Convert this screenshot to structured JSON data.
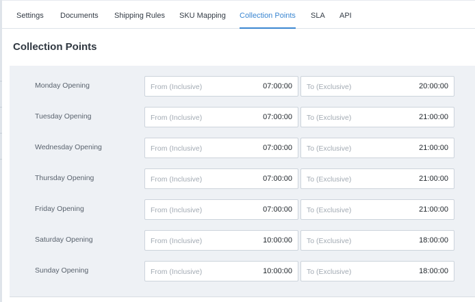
{
  "tabs": [
    {
      "label": "Settings",
      "active": false
    },
    {
      "label": "Documents",
      "active": false
    },
    {
      "label": "Shipping Rules",
      "active": false
    },
    {
      "label": "SKU Mapping",
      "active": false
    },
    {
      "label": "Collection Points",
      "active": true
    },
    {
      "label": "SLA",
      "active": false
    },
    {
      "label": "API",
      "active": false
    }
  ],
  "page": {
    "title": "Collection Points"
  },
  "rows": [
    {
      "day": "Monday Opening",
      "from_placeholder": "From (Inclusive)",
      "from_value": "07:00:00",
      "to_placeholder": "To (Exclusive)",
      "to_value": "20:00:00"
    },
    {
      "day": "Tuesday Opening",
      "from_placeholder": "From (Inclusive)",
      "from_value": "07:00:00",
      "to_placeholder": "To (Exclusive)",
      "to_value": "21:00:00"
    },
    {
      "day": "Wednesday Opening",
      "from_placeholder": "From (Inclusive)",
      "from_value": "07:00:00",
      "to_placeholder": "To (Exclusive)",
      "to_value": "21:00:00"
    },
    {
      "day": "Thursday Opening",
      "from_placeholder": "From (Inclusive)",
      "from_value": "07:00:00",
      "to_placeholder": "To (Exclusive)",
      "to_value": "21:00:00"
    },
    {
      "day": "Friday Opening",
      "from_placeholder": "From (Inclusive)",
      "from_value": "07:00:00",
      "to_placeholder": "To (Exclusive)",
      "to_value": "21:00:00"
    },
    {
      "day": "Saturday Opening",
      "from_placeholder": "From (Inclusive)",
      "from_value": "10:00:00",
      "to_placeholder": "To (Exclusive)",
      "to_value": "18:00:00"
    },
    {
      "day": "Sunday Opening",
      "from_placeholder": "From (Inclusive)",
      "from_value": "10:00:00",
      "to_placeholder": "To (Exclusive)",
      "to_value": "18:00:00"
    }
  ],
  "colors": {
    "accent": "#3a86d1",
    "panel_bg": "#eef1f5",
    "text": "#333b45"
  }
}
